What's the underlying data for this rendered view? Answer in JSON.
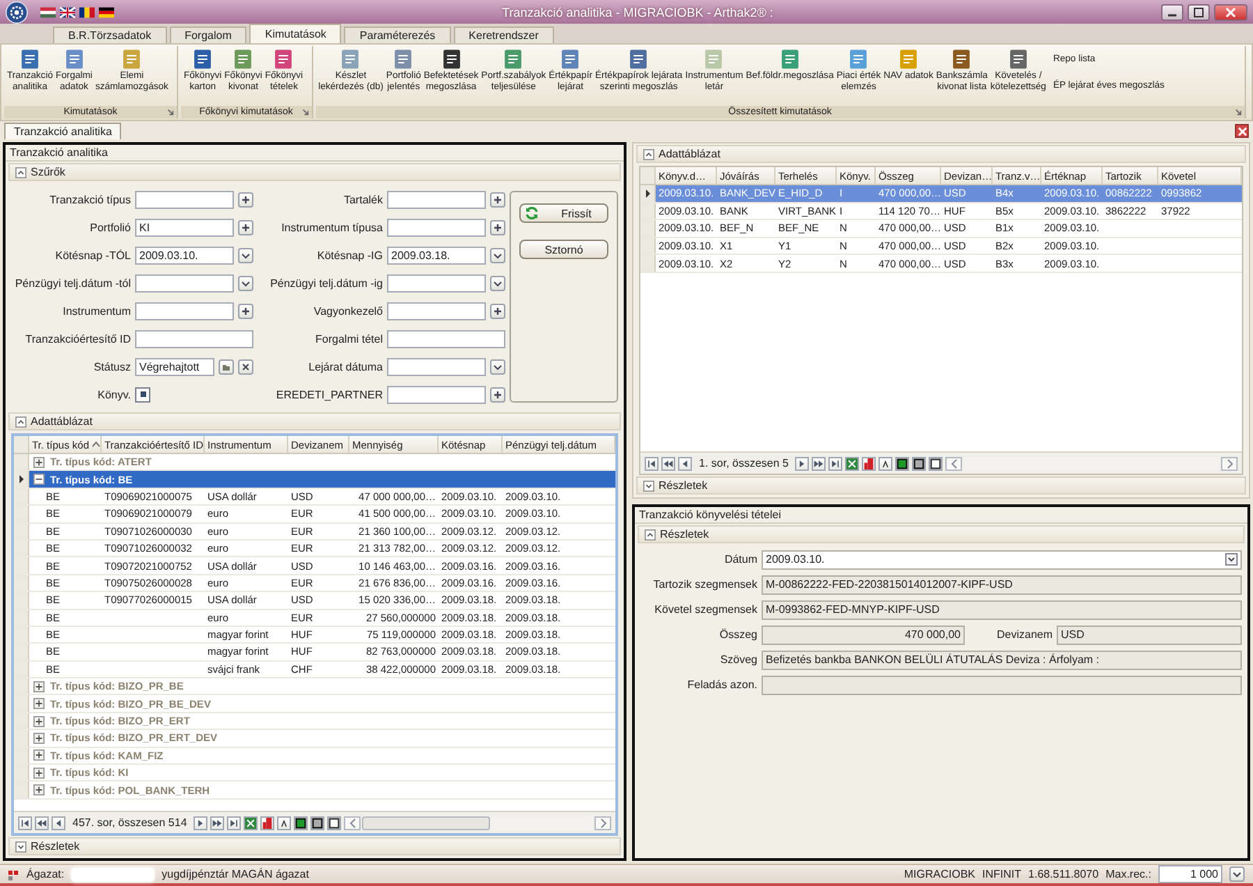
{
  "window": {
    "title": "Tranzakció analitika - MIGRACIOBK - Arthak2® :"
  },
  "ribbon": {
    "tabs": [
      {
        "label": "B.R.Törzsadatok",
        "selected": false
      },
      {
        "label": "Forgalom",
        "selected": false
      },
      {
        "label": "Kimutatások",
        "selected": true
      },
      {
        "label": "Paraméterezés",
        "selected": false
      },
      {
        "label": "Keretrendszer",
        "selected": false
      }
    ],
    "groups": [
      {
        "caption": "Kimutatások",
        "items": [
          {
            "label": "Tranzakció\nanalitika",
            "kind": "large"
          },
          {
            "label": "Forgalmi\nadatok",
            "kind": "large"
          },
          {
            "label": "Elemi\nszámlamozgások",
            "kind": "large"
          }
        ]
      },
      {
        "caption": "Főkönyvi kimutatások",
        "items": [
          {
            "label": "Főkönyvi\nkarton",
            "kind": "large"
          },
          {
            "label": "Főkönyvi\nkivonat",
            "kind": "large"
          },
          {
            "label": "Főkönyvi\ntételek",
            "kind": "large"
          }
        ]
      },
      {
        "caption": "Összesített kimutatások",
        "items": [
          {
            "label": "Készlet\nlekérdezés (db)",
            "kind": "large"
          },
          {
            "label": "Portfolió\njelentés",
            "kind": "large"
          },
          {
            "label": "Befektetések\nmegoszlása",
            "kind": "large"
          },
          {
            "label": "Portf.szabályok\nteljesülése",
            "kind": "large"
          },
          {
            "label": "Értékpapír\nlejárat",
            "kind": "large"
          },
          {
            "label": "Értékpapírok lejárata\nszerinti megoszlás",
            "kind": "large"
          },
          {
            "label": "Instrumentum\nletár",
            "kind": "large"
          },
          {
            "label": "Bef.földr.megoszlása",
            "kind": "large"
          },
          {
            "label": "Piaci érték\nelemzés",
            "kind": "large"
          },
          {
            "label": "NAV adatok",
            "kind": "large"
          },
          {
            "label": "Bankszámla\nkivonat lista",
            "kind": "large"
          },
          {
            "label": "Követelés /\nkötelezettség",
            "kind": "large"
          },
          {
            "label": "Repo lista",
            "kind": "small"
          },
          {
            "label": "ÉP lejárat éves megoszlás",
            "kind": "small"
          }
        ]
      }
    ]
  },
  "document_tabs": [
    {
      "label": "Tranzakció analitika",
      "selected": true
    }
  ],
  "left_panel": {
    "title": "Tranzakció analitika",
    "filters": {
      "title": "Szűrők",
      "expanded": true,
      "fields": [
        {
          "label": "Tranzakció típus",
          "kind": "lookup"
        },
        {
          "label": "Tartalék",
          "kind": "lookup"
        },
        {
          "label": "Portfolió",
          "value": "KI",
          "kind": "lookup"
        },
        {
          "label": "Instrumentum típusa",
          "kind": "lookup"
        },
        {
          "label": "Kötésnap -TÓL",
          "value": "2009.03.10.",
          "kind": "dropdown"
        },
        {
          "label": "Kötésnap -IG",
          "value": "2009.03.18.",
          "kind": "dropdown"
        },
        {
          "label": "Pénzügyi telj.dátum -tól",
          "kind": "dropdown"
        },
        {
          "label": "Pénzügyi telj.dátum -ig",
          "kind": "dropdown"
        },
        {
          "label": "Instrumentum",
          "kind": "lookup"
        },
        {
          "label": "Vagyonkezelő",
          "kind": "lookup"
        },
        {
          "label": "Tranzakcióértesítő ID",
          "kind": "text"
        },
        {
          "label": "Forgalmi tétel",
          "kind": "text"
        },
        {
          "label": "Státusz",
          "value": "Végrehajtott",
          "kind": "status"
        },
        {
          "label": "Lejárat dátuma",
          "kind": "dropdown"
        },
        {
          "label": "Könyv.",
          "kind": "checkbox",
          "checked": true
        },
        {
          "label": "EREDETI_PARTNER",
          "kind": "lookup"
        }
      ],
      "buttons": [
        {
          "label": "Frissít",
          "kind": "refresh"
        },
        {
          "label": "Sztornó",
          "kind": "plain"
        }
      ]
    },
    "table": {
      "title": "Adattáblázat",
      "expanded": true,
      "columns": [
        {
          "label": "Tr. típus kód",
          "sorted": true
        },
        {
          "label": "Tranzakcióértesítő ID",
          "sorted": false
        },
        {
          "label": "Instrumentum",
          "sorted": false
        },
        {
          "label": "Devizanem",
          "sorted": false
        },
        {
          "label": "Mennyiség",
          "sorted": false
        },
        {
          "label": "Kötésnap",
          "sorted": false
        },
        {
          "label": "Pénzügyi telj.dátum",
          "sorted": false
        }
      ],
      "groups": [
        {
          "label": "Tr. típus kód: ATERT",
          "expanded": false,
          "selected": false
        },
        {
          "label": "Tr. típus kód: BE",
          "expanded": true,
          "selected": true,
          "rows": [
            {
              "code": "BE",
              "id": "T09069021000075",
              "instrument": "USA dollár",
              "currency": "USD",
              "quantity": "47 000 000,00…",
              "trade_date": "2009.03.10.",
              "settlement_date": "2009.03.10.",
              "selected": false
            },
            {
              "code": "BE",
              "id": "T09069021000079",
              "instrument": "euro",
              "currency": "EUR",
              "quantity": "41 500 000,00…",
              "trade_date": "2009.03.10.",
              "settlement_date": "2009.03.10.",
              "selected": false
            },
            {
              "code": "BE",
              "id": "T09071026000030",
              "instrument": "euro",
              "currency": "EUR",
              "quantity": "21 360 100,00…",
              "trade_date": "2009.03.12.",
              "settlement_date": "2009.03.12.",
              "selected": false
            },
            {
              "code": "BE",
              "id": "T09071026000032",
              "instrument": "euro",
              "currency": "EUR",
              "quantity": "21 313 782,00…",
              "trade_date": "2009.03.12.",
              "settlement_date": "2009.03.12.",
              "selected": false
            },
            {
              "code": "BE",
              "id": "T09072021000752",
              "instrument": "USA dollár",
              "currency": "USD",
              "quantity": "10 146 463,00…",
              "trade_date": "2009.03.16.",
              "settlement_date": "2009.03.16.",
              "selected": false
            },
            {
              "code": "BE",
              "id": "T09075026000028",
              "instrument": "euro",
              "currency": "EUR",
              "quantity": "21 676 836,00…",
              "trade_date": "2009.03.16.",
              "settlement_date": "2009.03.16.",
              "selected": false
            },
            {
              "code": "BE",
              "id": "T09077026000015",
              "instrument": "USA dollár",
              "currency": "USD",
              "quantity": "15 020 336,00…",
              "trade_date": "2009.03.18.",
              "settlement_date": "2009.03.18.",
              "selected": false
            },
            {
              "code": "BE",
              "instrument": "euro",
              "currency": "EUR",
              "quantity": "27 560,000000",
              "trade_date": "2009.03.18.",
              "settlement_date": "2009.03.18.",
              "selected": false
            },
            {
              "code": "BE",
              "instrument": "magyar forint",
              "currency": "HUF",
              "quantity": "75 119,000000",
              "trade_date": "2009.03.18.",
              "settlement_date": "2009.03.18.",
              "selected": false
            },
            {
              "code": "BE",
              "instrument": "magyar forint",
              "currency": "HUF",
              "quantity": "82 763,000000",
              "trade_date": "2009.03.18.",
              "settlement_date": "2009.03.18.",
              "selected": false
            },
            {
              "code": "BE",
              "instrument": "svájci frank",
              "currency": "CHF",
              "quantity": "38 422,000000",
              "trade_date": "2009.03.18.",
              "settlement_date": "2009.03.18.",
              "selected": false
            }
          ]
        },
        {
          "label": "Tr. típus kód: BIZO_PR_BE",
          "expanded": false,
          "selected": false
        },
        {
          "label": "Tr. típus kód: BIZO_PR_BE_DEV",
          "expanded": false,
          "selected": false
        },
        {
          "label": "Tr. típus kód: BIZO_PR_ERT",
          "expanded": false,
          "selected": false
        },
        {
          "label": "Tr. típus kód: BIZO_PR_ERT_DEV",
          "expanded": false,
          "selected": false
        },
        {
          "label": "Tr. típus kód: KAM_FIZ",
          "expanded": false,
          "selected": false
        },
        {
          "label": "Tr. típus kód: KI",
          "expanded": false,
          "selected": false
        },
        {
          "label": "Tr. típus kód: POL_BANK_TERH",
          "expanded": false,
          "selected": false
        }
      ],
      "pager": "457. sor, összesen 514"
    },
    "details": {
      "title": "Részletek",
      "expanded": false
    }
  },
  "right_panel": {
    "table": {
      "title": "Adattáblázat",
      "expanded": true,
      "columns": [
        "Könyv.d…",
        "Jóváírás",
        "Terhelés",
        "Könyv.",
        "Összeg",
        "Devizan…",
        "Tranz.v…",
        "Értéknap",
        "Tartozik",
        "Követel"
      ],
      "rows": [
        {
          "booking_date": "2009.03.10.",
          "credit": "BANK_DEV",
          "debit": "E_HID_D",
          "booked": "I",
          "amount": "470 000,00…",
          "currency": "USD",
          "tranz_type": "B4x",
          "value_date": "2009.03.10.",
          "debit_account": "00862222",
          "credit_account": "0993862",
          "selected": true
        },
        {
          "booking_date": "2009.03.10.",
          "credit": "BANK",
          "debit": "VIRT_BANK",
          "booked": "I",
          "amount": "114 120 70…",
          "currency": "HUF",
          "tranz_type": "B5x",
          "value_date": "2009.03.10.",
          "debit_account": "3862222",
          "credit_account": "37922",
          "selected": false
        },
        {
          "booking_date": "2009.03.10.",
          "credit": "BEF_N",
          "debit": "BEF_NE",
          "booked": "N",
          "amount": "470 000,00…",
          "currency": "USD",
          "tranz_type": "B1x",
          "value_date": "2009.03.10.",
          "selected": false
        },
        {
          "booking_date": "2009.03.10.",
          "credit": "X1",
          "debit": "Y1",
          "booked": "N",
          "amount": "470 000,00…",
          "currency": "USD",
          "tranz_type": "B2x",
          "value_date": "2009.03.10.",
          "selected": false
        },
        {
          "booking_date": "2009.03.10.",
          "credit": "X2",
          "debit": "Y2",
          "booked": "N",
          "amount": "470 000,00…",
          "currency": "USD",
          "tranz_type": "B3x",
          "value_date": "2009.03.10.",
          "selected": false
        }
      ],
      "pager": "1. sor, összesen 5"
    },
    "details": {
      "title": "Részletek",
      "expanded": false
    }
  },
  "posting_panel": {
    "title": "Tranzakció könyvelési tételei",
    "details": {
      "title": "Részletek",
      "expanded": true,
      "rows": [
        [
          {
            "label": "Dátum",
            "value": "2009.03.10.",
            "kind": "dropdown"
          }
        ],
        [
          {
            "label": "Tartozik szegmensek",
            "value": "M-00862222-FED-2203815014012007-KIPF-USD",
            "kind": "readonly"
          }
        ],
        [
          {
            "label": "Követel szegmensek",
            "value": "M-0993862-FED-MNYP-KIPF-USD",
            "kind": "readonly"
          }
        ],
        [
          {
            "label": "Összeg",
            "value": "470 000,00",
            "kind": "amount"
          },
          {
            "label": "Devizanem",
            "value": "USD",
            "kind": "readonly"
          }
        ],
        [
          {
            "label": "Szöveg",
            "value": "Befizetés bankba BANKON BELÜLI ÁTUTALÁS Deviza : Árfolyam :",
            "kind": "readonly"
          }
        ],
        [
          {
            "label": "Feladás azon.",
            "kind": "readonly"
          }
        ]
      ]
    }
  },
  "status_bar": {
    "sector_label": "Ágazat:",
    "sector": "yugdíjpénztár MAGÁN ágazat",
    "items": [
      "MIGRACIOBK",
      "INFINIT",
      "1.68.511.8070"
    ],
    "max_rec_label": "Max.rec.:",
    "max_rec": "1 000"
  }
}
